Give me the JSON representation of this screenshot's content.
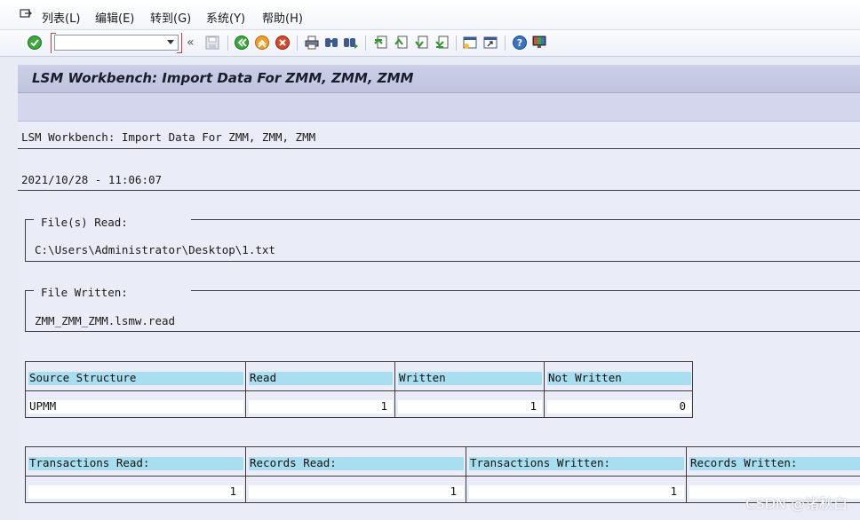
{
  "menu": {
    "items": [
      {
        "label": "列表(L)"
      },
      {
        "label": "编辑(E)"
      },
      {
        "label": "转到(G)"
      },
      {
        "label": "系统(Y)"
      },
      {
        "label": "帮助(H)"
      }
    ]
  },
  "toolbar": {
    "command_value": "",
    "collapse_glyph": "«",
    "icons": [
      "enter-icon",
      "save-icon",
      "back-icon",
      "exit-icon",
      "cancel-icon",
      "print-icon",
      "find-icon",
      "find-next-icon",
      "first-page-icon",
      "previous-page-icon",
      "next-page-icon",
      "last-page-icon",
      "create-session-icon",
      "shortcut-icon",
      "help-icon",
      "customize-layout-icon"
    ]
  },
  "title": "LSM Workbench: Import Data For ZMM, ZMM, ZMM",
  "report": {
    "heading": "LSM Workbench: Import Data For ZMM, ZMM, ZMM",
    "timestamp": "2021/10/28 - 11:06:07",
    "files_read_label": "File(s) Read:",
    "files_read_value": "C:\\Users\\Administrator\\Desktop\\1.txt",
    "file_written_label": "File Written:",
    "file_written_value": "ZMM_ZMM_ZMM.lsmw.read"
  },
  "structure_table": {
    "headers": [
      "Source Structure",
      "Read",
      "Written",
      "Not Written"
    ],
    "row": [
      "UPMM",
      "1",
      "1",
      "0"
    ]
  },
  "totals_table": {
    "headers": [
      "Transactions Read:",
      "Records Read:",
      "Transactions Written:",
      "Records Written:"
    ],
    "row": [
      "1",
      "1",
      "1",
      ""
    ]
  },
  "watermark": "CSDN @诸秋白",
  "colors": {
    "header_fill": "#a8dff0",
    "title_bar": "#c6cae2",
    "text_blue": "#2d4a8e",
    "ok_green": "#2e9a2e",
    "nav_orange": "#f0a020",
    "cancel_red": "#d9472b"
  }
}
